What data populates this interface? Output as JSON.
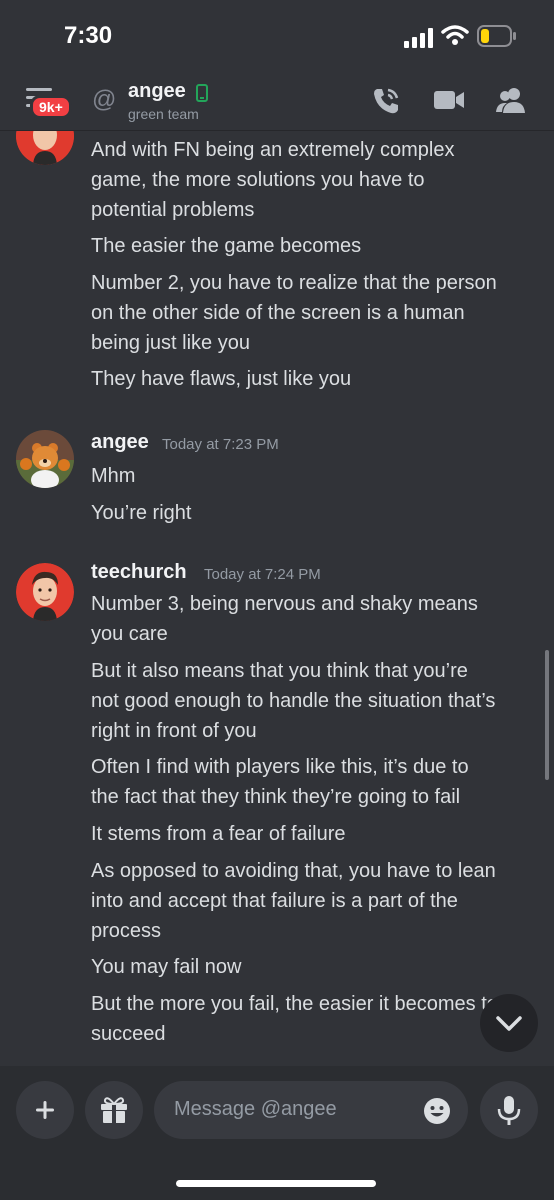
{
  "status": {
    "time": "7:30"
  },
  "header": {
    "badge": "9k+",
    "at_symbol": "@",
    "name": "angee",
    "subtitle": "green team",
    "icons": [
      "hamburger-icon",
      "phone-icon",
      "video-icon",
      "members-icon"
    ]
  },
  "messages": [
    {
      "author": "",
      "time": "",
      "lines": [
        "And with FN being an extremely complex",
        "game, the more solutions you have to",
        "potential problems",
        "The easier the game becomes",
        "Number 2, you have to realize that the person",
        "on the other side of the screen is a human",
        "being just like you",
        "They have flaws, just like you"
      ]
    },
    {
      "author": "angee",
      "time": "Today at 7:23 PM",
      "lines": [
        "Mhm",
        "You’re right"
      ]
    },
    {
      "author": "teechurch",
      "time": "Today at 7:24 PM",
      "lines": [
        "Number 3, being nervous and shaky means",
        "you care",
        "But it also means that you think that you’re",
        "not good enough to handle the situation that’s",
        "right in front of you",
        "Often I find with players like this, it’s due to",
        "the fact that they think they’re going to fail",
        "It stems from a fear of failure",
        "As opposed to avoiding that, you have to lean",
        "into and accept that failure is a part of the",
        "process",
        "You may fail now",
        "But the more you fail, the easier it becomes to",
        "succeed"
      ]
    }
  ],
  "composer": {
    "placeholder": "Message @angee",
    "icons": [
      "plus-icon",
      "gift-icon",
      "emoji-icon",
      "microphone-icon"
    ]
  },
  "colors": {
    "background": "#313338",
    "composer": "#2b2d31",
    "badge": "#f23f43",
    "online": "#23a55a"
  }
}
